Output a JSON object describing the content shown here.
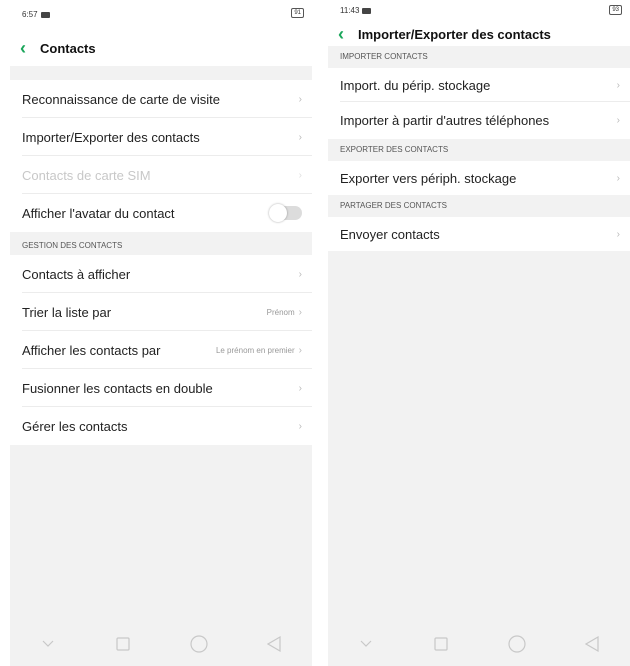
{
  "left": {
    "status": {
      "time": "6:57",
      "battery": "91"
    },
    "title": "Contacts",
    "rows_top": [
      {
        "label": "Reconnaissance de carte de visite",
        "value": ""
      },
      {
        "label": "Importer/Exporter des contacts",
        "value": ""
      },
      {
        "label": "Contacts de carte SIM",
        "value": ""
      },
      {
        "label": "Afficher l'avatar du contact",
        "value": ""
      }
    ],
    "section_gestion": "GESTION DES CONTACTS",
    "rows_gestion": [
      {
        "label": "Contacts à afficher",
        "value": ""
      },
      {
        "label": "Trier la liste par",
        "value": "Prénom"
      },
      {
        "label": "Afficher les contacts par",
        "value": "Le prénom en premier"
      },
      {
        "label": "Fusionner les contacts en double",
        "value": ""
      },
      {
        "label": "Gérer les contacts",
        "value": ""
      }
    ]
  },
  "right": {
    "status": {
      "time": "11:43",
      "battery": "93"
    },
    "title": "Importer/Exporter des contacts",
    "section_import": "IMPORTER CONTACTS",
    "rows_import": [
      {
        "label": "Import. du périp. stockage"
      },
      {
        "label": "Importer à partir d'autres téléphones"
      }
    ],
    "section_export": "EXPORTER DES CONTACTS",
    "rows_export": [
      {
        "label": "Exporter vers périph. stockage"
      }
    ],
    "section_share": "PARTAGER DES CONTACTS",
    "rows_share": [
      {
        "label": "Envoyer contacts"
      }
    ]
  },
  "icons": {
    "back": "chevron-left-icon",
    "chevron": "chevron-right-icon",
    "nav": [
      "chevron-down-icon",
      "square-icon",
      "circle-icon",
      "triangle-back-icon"
    ]
  },
  "colors": {
    "accent": "#1aa65a",
    "background": "#f2f2f2"
  }
}
